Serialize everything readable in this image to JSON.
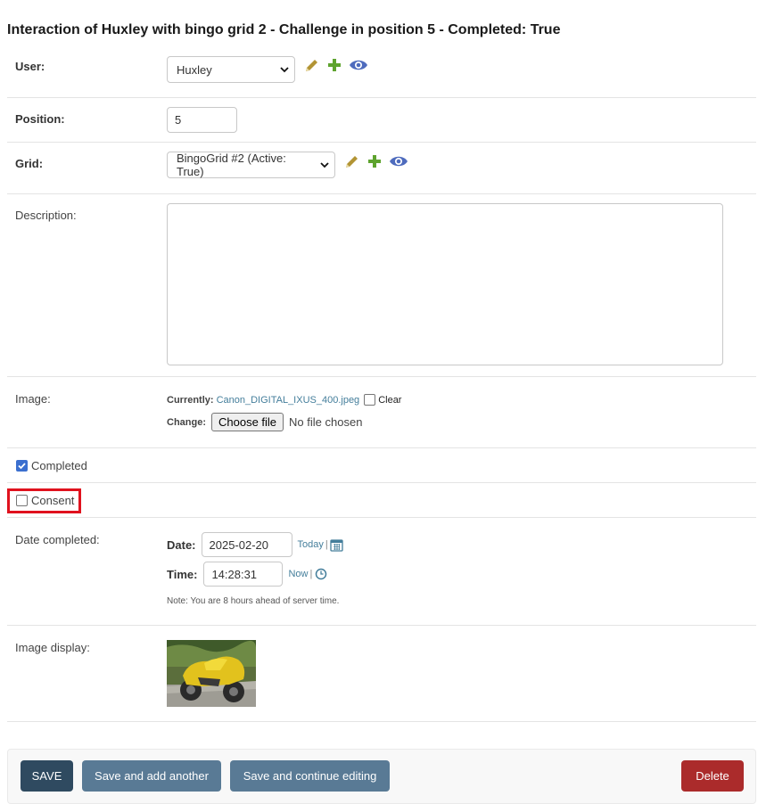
{
  "page": {
    "title": "Interaction of Huxley with bingo grid 2 - Challenge in position 5 - Completed: True"
  },
  "user": {
    "label": "User:",
    "value": "Huxley"
  },
  "position": {
    "label": "Position:",
    "value": "5"
  },
  "grid": {
    "label": "Grid:",
    "value": "BingoGrid #2 (Active: True)"
  },
  "description": {
    "label": "Description:",
    "value": ""
  },
  "image": {
    "label": "Image:",
    "currently_label": "Currently:",
    "current_file": "Canon_DIGITAL_IXUS_400.jpeg",
    "clear_label": "Clear",
    "change_label": "Change:",
    "choose_button": "Choose file",
    "no_file_text": "No file chosen"
  },
  "completed": {
    "label": "Completed",
    "checked": true
  },
  "consent": {
    "label": "Consent",
    "checked": false
  },
  "date_completed": {
    "label": "Date completed:",
    "date_label": "Date:",
    "date_value": "2025-02-20",
    "today_link": "Today",
    "time_label": "Time:",
    "time_value": "14:28:31",
    "now_link": "Now",
    "separator": "|",
    "note": "Note: You are 8 hours ahead of server time."
  },
  "image_display": {
    "label": "Image display:",
    "alt": "yellow motorcycle photo"
  },
  "footer": {
    "save": "SAVE",
    "save_add": "Save and add another",
    "save_continue": "Save and continue editing",
    "delete": "Delete"
  },
  "colors": {
    "save_bg": "#2f4a60",
    "secondary_bg": "#597a95",
    "delete_bg": "#ab2b2b",
    "pencil": "#b29434",
    "plus": "#5ea32e",
    "eye": "#4e6bbd",
    "highlight": "#e0121e"
  }
}
